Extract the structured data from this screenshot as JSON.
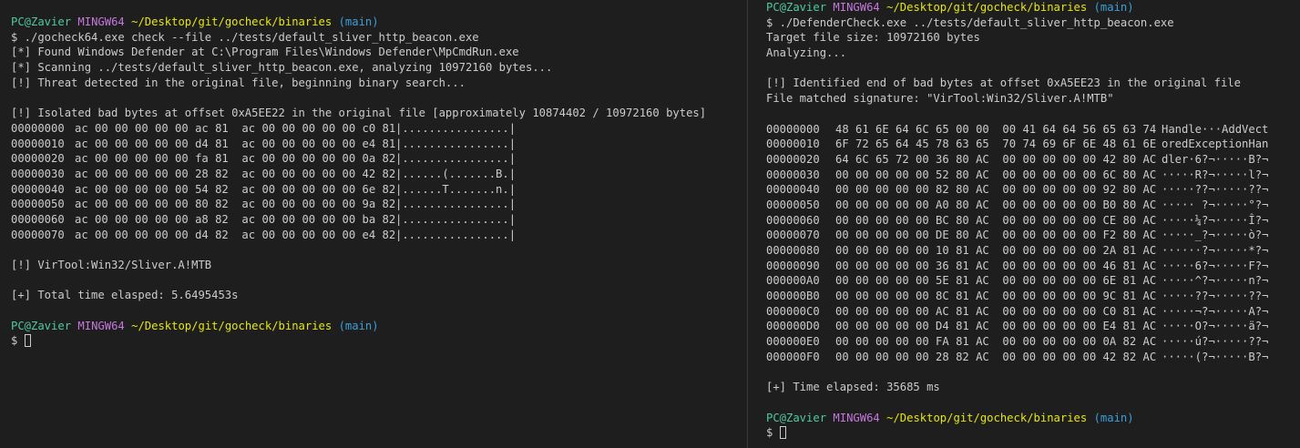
{
  "prompt": {
    "user": "PC@Zavier",
    "env": "MINGW64",
    "path": "~/Desktop/git/gocheck/binaries",
    "branch": "(main)",
    "dollar": "$"
  },
  "left": {
    "command": "$ ./gocheck64.exe check --file ../tests/default_sliver_http_beacon.exe",
    "out1": "[*] Found Windows Defender at C:\\Program Files\\Windows Defender\\MpCmdRun.exe",
    "out2": "[*] Scanning ../tests/default_sliver_http_beacon.exe, analyzing 10972160 bytes...",
    "out3": "[!] Threat detected in the original file, beginning binary search...",
    "isolated": "[!] Isolated bad bytes at offset 0xA5EE22 in the original file [approximately 10874402 / 10972160 bytes]",
    "hex": [
      {
        "off": "00000000",
        "bytes": "ac 00 00 00 00 00 ac 81  ac 00 00 00 00 00 c0 81",
        "ascii": "|................|"
      },
      {
        "off": "00000010",
        "bytes": "ac 00 00 00 00 00 d4 81  ac 00 00 00 00 00 e4 81",
        "ascii": "|................|"
      },
      {
        "off": "00000020",
        "bytes": "ac 00 00 00 00 00 fa 81  ac 00 00 00 00 00 0a 82",
        "ascii": "|................|"
      },
      {
        "off": "00000030",
        "bytes": "ac 00 00 00 00 00 28 82  ac 00 00 00 00 00 42 82",
        "ascii": "|......(.......B.|"
      },
      {
        "off": "00000040",
        "bytes": "ac 00 00 00 00 00 54 82  ac 00 00 00 00 00 6e 82",
        "ascii": "|......T.......n.|"
      },
      {
        "off": "00000050",
        "bytes": "ac 00 00 00 00 00 80 82  ac 00 00 00 00 00 9a 82",
        "ascii": "|................|"
      },
      {
        "off": "00000060",
        "bytes": "ac 00 00 00 00 00 a8 82  ac 00 00 00 00 00 ba 82",
        "ascii": "|................|"
      },
      {
        "off": "00000070",
        "bytes": "ac 00 00 00 00 00 d4 82  ac 00 00 00 00 00 e4 82",
        "ascii": "|................|"
      }
    ],
    "sig": "[!] VirTool:Win32/Sliver.A!MTB",
    "time": "[+] Total time elasped: 5.6495453s"
  },
  "right": {
    "command": "$ ./DefenderCheck.exe ../tests/default_sliver_http_beacon.exe",
    "size": "Target file size: 10972160 bytes",
    "analyzing": "Analyzing...",
    "identified": "[!] Identified end of bad bytes at offset 0xA5EE23 in the original file",
    "matched": "File matched signature: \"VirTool:Win32/Sliver.A!MTB\"",
    "hex": [
      {
        "off": "00000000",
        "bytes": "48 61 6E 64 6C 65 00 00  00 41 64 64 56 65 63 74",
        "ascii": "Handle···AddVect"
      },
      {
        "off": "00000010",
        "bytes": "6F 72 65 64 45 78 63 65  70 74 69 6F 6E 48 61 6E",
        "ascii": "oredExceptionHan"
      },
      {
        "off": "00000020",
        "bytes": "64 6C 65 72 00 36 80 AC  00 00 00 00 00 42 80 AC",
        "ascii": "dler·6?¬·····B?¬"
      },
      {
        "off": "00000030",
        "bytes": "00 00 00 00 00 52 80 AC  00 00 00 00 00 6C 80 AC",
        "ascii": "·····R?¬·····l?¬"
      },
      {
        "off": "00000040",
        "bytes": "00 00 00 00 00 82 80 AC  00 00 00 00 00 92 80 AC",
        "ascii": "·····??¬·····??¬"
      },
      {
        "off": "00000050",
        "bytes": "00 00 00 00 00 A0 80 AC  00 00 00 00 00 B0 80 AC",
        "ascii": "····· ?¬·····°?¬"
      },
      {
        "off": "00000060",
        "bytes": "00 00 00 00 00 BC 80 AC  00 00 00 00 00 CE 80 AC",
        "ascii": "·····¼?¬·····Î?¬"
      },
      {
        "off": "00000070",
        "bytes": "00 00 00 00 00 DE 80 AC  00 00 00 00 00 F2 80 AC",
        "ascii": "·····_?¬·····ò?¬"
      },
      {
        "off": "00000080",
        "bytes": "00 00 00 00 00 10 81 AC  00 00 00 00 00 2A 81 AC",
        "ascii": "······?¬·····*?¬"
      },
      {
        "off": "00000090",
        "bytes": "00 00 00 00 00 36 81 AC  00 00 00 00 00 46 81 AC",
        "ascii": "·····6?¬·····F?¬"
      },
      {
        "off": "000000A0",
        "bytes": "00 00 00 00 00 5E 81 AC  00 00 00 00 00 6E 81 AC",
        "ascii": "·····^?¬·····n?¬"
      },
      {
        "off": "000000B0",
        "bytes": "00 00 00 00 00 8C 81 AC  00 00 00 00 00 9C 81 AC",
        "ascii": "·····??¬·····??¬"
      },
      {
        "off": "000000C0",
        "bytes": "00 00 00 00 00 AC 81 AC  00 00 00 00 00 C0 81 AC",
        "ascii": "·····¬?¬·····A?¬"
      },
      {
        "off": "000000D0",
        "bytes": "00 00 00 00 00 D4 81 AC  00 00 00 00 00 E4 81 AC",
        "ascii": "·····O?¬·····ä?¬"
      },
      {
        "off": "000000E0",
        "bytes": "00 00 00 00 00 FA 81 AC  00 00 00 00 00 0A 82 AC",
        "ascii": "·····ú?¬·····??¬"
      },
      {
        "off": "000000F0",
        "bytes": "00 00 00 00 00 28 82 AC  00 00 00 00 00 42 82 AC",
        "ascii": "·····(?¬·····B?¬"
      }
    ],
    "time": "[+] Time elapsed: 35685 ms"
  }
}
